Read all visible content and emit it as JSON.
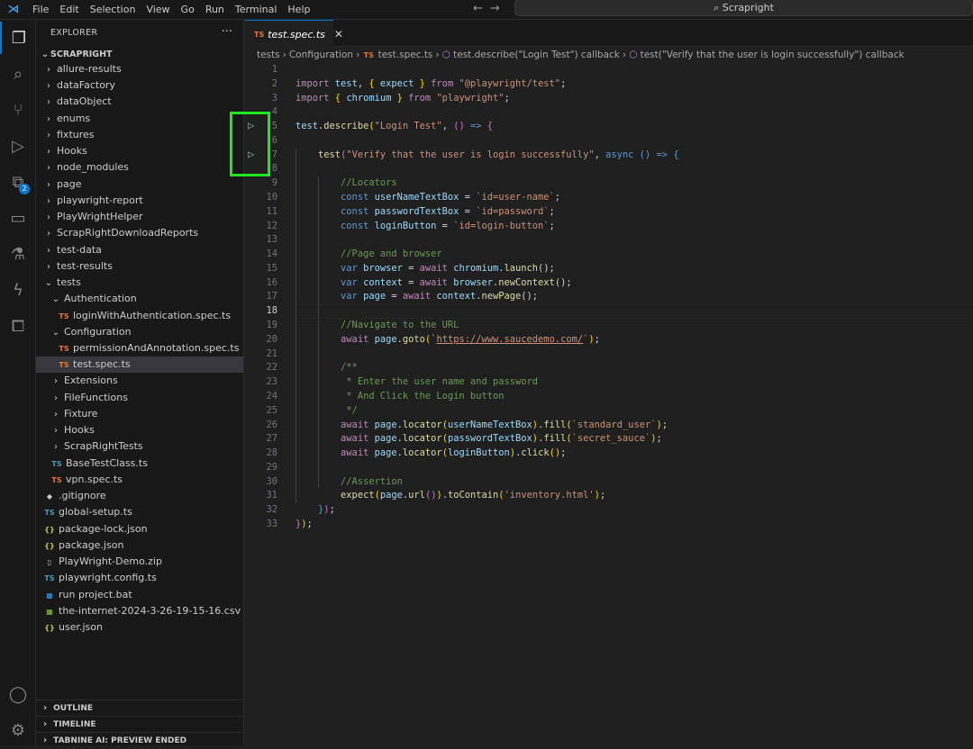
{
  "menu": [
    "File",
    "Edit",
    "Selection",
    "View",
    "Go",
    "Run",
    "Terminal",
    "Help"
  ],
  "command_center": "Scrapright",
  "activity": {
    "extensions_badge": "2"
  },
  "explorer": {
    "title": "EXPLORER",
    "root": "SCRAPRIGHT",
    "items": [
      {
        "label": "allure-results",
        "type": "folder",
        "depth": 1
      },
      {
        "label": "dataFactory",
        "type": "folder",
        "depth": 1
      },
      {
        "label": "dataObject",
        "type": "folder",
        "depth": 1
      },
      {
        "label": "enums",
        "type": "folder",
        "depth": 1
      },
      {
        "label": "fixtures",
        "type": "folder",
        "depth": 1
      },
      {
        "label": "Hooks",
        "type": "folder",
        "depth": 1
      },
      {
        "label": "node_modules",
        "type": "folder",
        "depth": 1
      },
      {
        "label": "page",
        "type": "folder",
        "depth": 1
      },
      {
        "label": "playwright-report",
        "type": "folder",
        "depth": 1
      },
      {
        "label": "PlayWrightHelper",
        "type": "folder",
        "depth": 1
      },
      {
        "label": "ScrapRightDownloadReports",
        "type": "folder",
        "depth": 1
      },
      {
        "label": "test-data",
        "type": "folder",
        "depth": 1
      },
      {
        "label": "test-results",
        "type": "folder",
        "depth": 1
      },
      {
        "label": "tests",
        "type": "open",
        "depth": 1
      },
      {
        "label": "Authentication",
        "type": "open",
        "depth": 2
      },
      {
        "label": "loginWithAuthentication.spec.ts",
        "type": "ts",
        "icon": "TS",
        "depth": 3
      },
      {
        "label": "Configuration",
        "type": "open",
        "depth": 2
      },
      {
        "label": "permissionAndAnnotation.spec.ts",
        "type": "ts",
        "icon": "TS",
        "depth": 3
      },
      {
        "label": "test.spec.ts",
        "type": "ts",
        "icon": "TS",
        "depth": 3,
        "selected": true
      },
      {
        "label": "Extensions",
        "type": "folder",
        "depth": 2
      },
      {
        "label": "FileFunctions",
        "type": "folder",
        "depth": 2
      },
      {
        "label": "Fixture",
        "type": "folder",
        "depth": 2
      },
      {
        "label": "Hooks",
        "type": "folder",
        "depth": 2
      },
      {
        "label": "ScrapRightTests",
        "type": "folder",
        "depth": 2
      },
      {
        "label": "BaseTestClass.ts",
        "type": "tsb",
        "icon": "TS",
        "depth": 2
      },
      {
        "label": "vpn.spec.ts",
        "type": "ts",
        "icon": "TS",
        "depth": 2
      },
      {
        "label": ".gitignore",
        "type": "zip",
        "icon": "◆",
        "depth": 1
      },
      {
        "label": "global-setup.ts",
        "type": "tsb",
        "icon": "TS",
        "depth": 1
      },
      {
        "label": "package-lock.json",
        "type": "json",
        "icon": "{}",
        "depth": 1
      },
      {
        "label": "package.json",
        "type": "json",
        "icon": "{}",
        "depth": 1
      },
      {
        "label": "PlayWright-Demo.zip",
        "type": "zip",
        "icon": "▯",
        "depth": 1
      },
      {
        "label": "playwright.config.ts",
        "type": "tsb",
        "icon": "TS",
        "depth": 1
      },
      {
        "label": "run project.bat",
        "type": "bat",
        "icon": "▦",
        "depth": 1
      },
      {
        "label": "the-internet-2024-3-26-19-15-16.csv",
        "type": "csv",
        "icon": "▦",
        "depth": 1
      },
      {
        "label": "user.json",
        "type": "json",
        "icon": "{}",
        "depth": 1
      }
    ],
    "panels": [
      "OUTLINE",
      "TIMELINE",
      "TABNINE AI: PREVIEW ENDED"
    ]
  },
  "tab": {
    "icon": "TS",
    "label": "test.spec.ts",
    "close": "✕"
  },
  "breadcrumb": {
    "parts": [
      "tests",
      "Configuration"
    ],
    "file_icon": "TS",
    "file": "test.spec.ts",
    "symbols": [
      "test.describe(\"Login Test\") callback",
      "test(\"Verify that the user is login successfully\") callback"
    ]
  },
  "editor": {
    "current_line": 18,
    "run_lines": [
      5,
      7
    ],
    "lines": [
      [],
      [
        [
          "import ",
          "k"
        ],
        [
          "test",
          "v"
        ],
        [
          ", ",
          "o"
        ],
        [
          "{ ",
          "br"
        ],
        [
          "expect ",
          "v"
        ],
        [
          "} ",
          "br"
        ],
        [
          "from ",
          "k"
        ],
        [
          "\"@playwright/test\"",
          "s"
        ],
        [
          ";",
          "o"
        ]
      ],
      [
        [
          "import ",
          "k"
        ],
        [
          "{ ",
          "br"
        ],
        [
          "chromium ",
          "v"
        ],
        [
          "} ",
          "br"
        ],
        [
          "from ",
          "k"
        ],
        [
          "\"playwright\"",
          "s"
        ],
        [
          ";",
          "o"
        ]
      ],
      [],
      [
        [
          "test",
          "v"
        ],
        [
          ".",
          "o"
        ],
        [
          "describe",
          "f"
        ],
        [
          "(",
          "br"
        ],
        [
          "\"Login Test\"",
          "s"
        ],
        [
          ", ",
          "o"
        ],
        [
          "() ",
          "p"
        ],
        [
          "=> ",
          "b"
        ],
        [
          "{",
          "p"
        ]
      ],
      [],
      [
        [
          "    ",
          "o"
        ],
        [
          "test",
          "f"
        ],
        [
          "(",
          "p"
        ],
        [
          "\"Verify that the user is login successfully\"",
          "s"
        ],
        [
          ", ",
          "o"
        ],
        [
          "async ",
          "b"
        ],
        [
          "() ",
          "b"
        ],
        [
          "=> ",
          "b"
        ],
        [
          "{",
          "b"
        ]
      ],
      [],
      [
        [
          "        //Locators",
          "c"
        ]
      ],
      [
        [
          "        ",
          "o"
        ],
        [
          "const ",
          "b"
        ],
        [
          "userNameTextBox ",
          "v"
        ],
        [
          "= ",
          "o"
        ],
        [
          "`id=user-name`",
          "s"
        ],
        [
          ";",
          "o"
        ]
      ],
      [
        [
          "        ",
          "o"
        ],
        [
          "const ",
          "b"
        ],
        [
          "passwordTextBox ",
          "v"
        ],
        [
          "= ",
          "o"
        ],
        [
          "`id=password`",
          "s"
        ],
        [
          ";",
          "o"
        ]
      ],
      [
        [
          "        ",
          "o"
        ],
        [
          "const ",
          "b"
        ],
        [
          "loginButton ",
          "v"
        ],
        [
          "= ",
          "o"
        ],
        [
          "`id=login-button`",
          "s"
        ],
        [
          ";",
          "o"
        ]
      ],
      [],
      [
        [
          "        //Page and browser",
          "c"
        ]
      ],
      [
        [
          "        ",
          "o"
        ],
        [
          "var ",
          "b"
        ],
        [
          "browser ",
          "v"
        ],
        [
          "= ",
          "o"
        ],
        [
          "await ",
          "k"
        ],
        [
          "chromium",
          "v"
        ],
        [
          ".",
          "o"
        ],
        [
          "launch",
          "f"
        ],
        [
          "();",
          "o"
        ]
      ],
      [
        [
          "        ",
          "o"
        ],
        [
          "var ",
          "b"
        ],
        [
          "context ",
          "v"
        ],
        [
          "= ",
          "o"
        ],
        [
          "await ",
          "k"
        ],
        [
          "browser",
          "v"
        ],
        [
          ".",
          "o"
        ],
        [
          "newContext",
          "f"
        ],
        [
          "();",
          "o"
        ]
      ],
      [
        [
          "        ",
          "o"
        ],
        [
          "var ",
          "b"
        ],
        [
          "page ",
          "v"
        ],
        [
          "= ",
          "o"
        ],
        [
          "await ",
          "k"
        ],
        [
          "context",
          "v"
        ],
        [
          ".",
          "o"
        ],
        [
          "newPage",
          "f"
        ],
        [
          "();",
          "o"
        ]
      ],
      [],
      [
        [
          "        //Navigate to the URL",
          "c"
        ]
      ],
      [
        [
          "        ",
          "o"
        ],
        [
          "await ",
          "k"
        ],
        [
          "page",
          "v"
        ],
        [
          ".",
          "o"
        ],
        [
          "goto",
          "f"
        ],
        [
          "(",
          "br"
        ],
        [
          "`",
          "s"
        ],
        [
          "https://www.saucedemo.com/",
          "u"
        ],
        [
          "`",
          "s"
        ],
        [
          ")",
          "br"
        ],
        [
          ";",
          "o"
        ]
      ],
      [],
      [
        [
          "        /**",
          "c"
        ]
      ],
      [
        [
          "         * Enter the user name and password",
          "c"
        ]
      ],
      [
        [
          "         * And Click the Login button",
          "c"
        ]
      ],
      [
        [
          "         */",
          "c"
        ]
      ],
      [
        [
          "        ",
          "o"
        ],
        [
          "await ",
          "k"
        ],
        [
          "page",
          "v"
        ],
        [
          ".",
          "o"
        ],
        [
          "locator",
          "f"
        ],
        [
          "(",
          "br"
        ],
        [
          "userNameTextBox",
          "v"
        ],
        [
          ")",
          "br"
        ],
        [
          ".",
          "o"
        ],
        [
          "fill",
          "f"
        ],
        [
          "(",
          "br"
        ],
        [
          "`standard_user`",
          "s"
        ],
        [
          ")",
          "br"
        ],
        [
          ";",
          "o"
        ]
      ],
      [
        [
          "        ",
          "o"
        ],
        [
          "await ",
          "k"
        ],
        [
          "page",
          "v"
        ],
        [
          ".",
          "o"
        ],
        [
          "locator",
          "f"
        ],
        [
          "(",
          "br"
        ],
        [
          "passwordTextBox",
          "v"
        ],
        [
          ")",
          "br"
        ],
        [
          ".",
          "o"
        ],
        [
          "fill",
          "f"
        ],
        [
          "(",
          "br"
        ],
        [
          "`secret_sauce`",
          "s"
        ],
        [
          ")",
          "br"
        ],
        [
          ";",
          "o"
        ]
      ],
      [
        [
          "        ",
          "o"
        ],
        [
          "await ",
          "k"
        ],
        [
          "page",
          "v"
        ],
        [
          ".",
          "o"
        ],
        [
          "locator",
          "f"
        ],
        [
          "(",
          "br"
        ],
        [
          "loginButton",
          "v"
        ],
        [
          ")",
          "br"
        ],
        [
          ".",
          "o"
        ],
        [
          "click",
          "f"
        ],
        [
          "()",
          "br"
        ],
        [
          ";",
          "o"
        ]
      ],
      [],
      [
        [
          "        //Assertion",
          "c"
        ]
      ],
      [
        [
          "        ",
          "o"
        ],
        [
          "expect",
          "f"
        ],
        [
          "(",
          "br"
        ],
        [
          "page",
          "v"
        ],
        [
          ".",
          "o"
        ],
        [
          "url",
          "f"
        ],
        [
          "()",
          "p"
        ],
        [
          ")",
          "br"
        ],
        [
          ".",
          "o"
        ],
        [
          "toContain",
          "f"
        ],
        [
          "(",
          "br"
        ],
        [
          "'inventory.html'",
          "s"
        ],
        [
          ")",
          "br"
        ],
        [
          ";",
          "o"
        ]
      ],
      [
        [
          "    ",
          "o"
        ],
        [
          "}",
          "b"
        ],
        [
          ")",
          "p"
        ],
        [
          ";",
          "o"
        ]
      ],
      [
        [
          "}",
          "p"
        ],
        [
          ")",
          "br"
        ],
        [
          ";",
          "o"
        ]
      ]
    ]
  }
}
